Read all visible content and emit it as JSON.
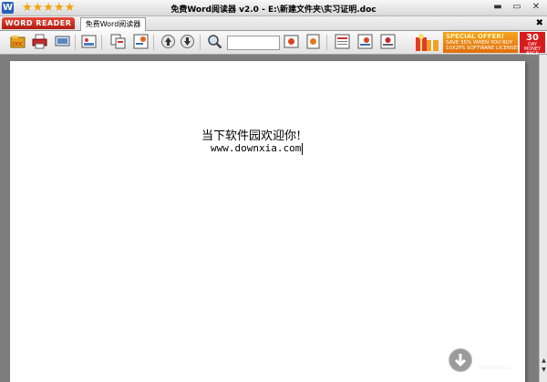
{
  "window": {
    "title": "免费Word阅读器 v2.0 - E:\\新建文件夹\\实习证明.doc",
    "rating": "★★★★★",
    "app_icon_letter": "W",
    "minimize": "▬",
    "maximize": "▭",
    "close": "✕"
  },
  "tabs": {
    "logo_label": "WORD READER",
    "document_tab_label": "免费Word阅读器",
    "close_label": "✖"
  },
  "toolbar": {
    "search_value": "",
    "buttons": [
      "open-icon",
      "print-icon",
      "display-icon",
      "image-icon",
      "copy-icon",
      "export-icon",
      "page-up-icon",
      "page-down-icon",
      "zoom-icon",
      "fit-width-icon",
      "fit-page-icon",
      "view1-icon",
      "view2-icon",
      "view3-icon"
    ]
  },
  "promo": {
    "line1": "SPECIAL OFFER!",
    "line2": "SAVE 35% WHEN YOU BUY",
    "line3": "10X2PS SOFTWARE LICENSES.",
    "badge_num": "30",
    "badge_text": "DAY MONEY BACK"
  },
  "document": {
    "line1": "当下软件园欢迎你!",
    "line2": "www.downxia.com"
  },
  "watermark": {
    "name": "当下软件",
    "url": "downxia.c"
  },
  "colors": {
    "workspace": "#7d7d7d",
    "logo_red": "#c8261a",
    "star": "#f3a40a",
    "promo_orange": "#f0901a",
    "badge_red": "#d81c1c"
  }
}
